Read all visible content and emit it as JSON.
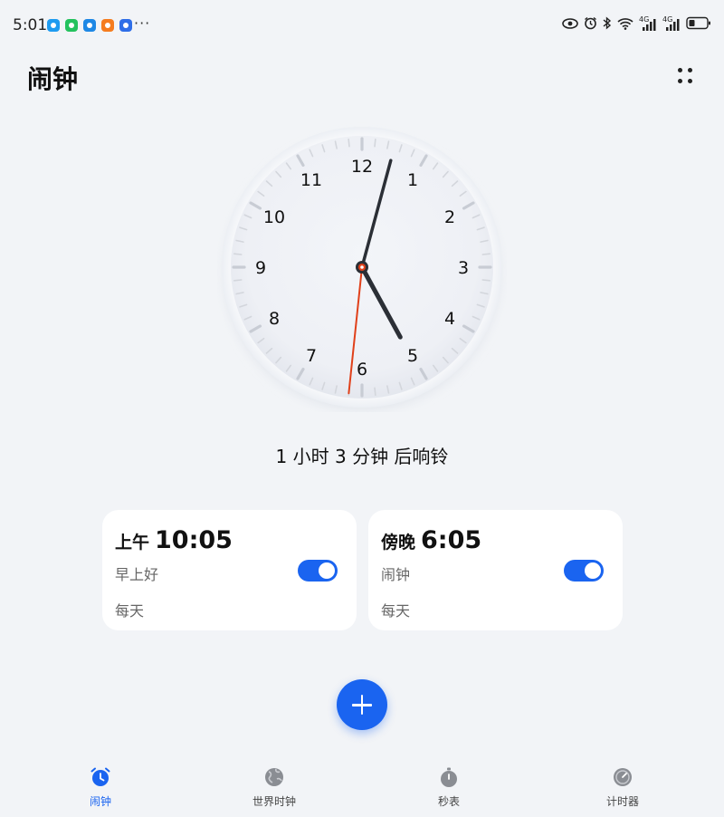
{
  "status_bar": {
    "time": "5:01",
    "more": "···",
    "signal_label_1": "4G",
    "signal_label_2": "4G",
    "app_colors": [
      "#1e9bf0",
      "#24c25e",
      "#1e88e5",
      "#f57c1f",
      "#2f6ee8"
    ]
  },
  "header": {
    "title": "闹钟",
    "menu_icon": "more-grid-icon"
  },
  "clock": {
    "numerals": [
      "12",
      "1",
      "2",
      "3",
      "4",
      "5",
      "6",
      "7",
      "8",
      "9",
      "10",
      "11"
    ],
    "time_shown": {
      "hour": 5,
      "minute": 2,
      "second": 31
    },
    "hand_color": "#2b2f36",
    "second_hand_color": "#e0401a"
  },
  "countdown_text": "1 小时 3 分钟 后响铃",
  "alarms": [
    {
      "period": "上午",
      "time": "10:05",
      "label": "早上好",
      "repeat": "每天",
      "enabled": true
    },
    {
      "period": "傍晚",
      "time": "6:05",
      "label": "闹钟",
      "repeat": "每天",
      "enabled": true
    }
  ],
  "fab": {
    "icon": "plus-icon",
    "color": "#1a64f0"
  },
  "nav": {
    "items": [
      {
        "label": "闹钟",
        "icon": "alarm-clock-icon",
        "active": true
      },
      {
        "label": "世界时钟",
        "icon": "globe-icon",
        "active": false
      },
      {
        "label": "秒表",
        "icon": "stopwatch-icon",
        "active": false
      },
      {
        "label": "计时器",
        "icon": "timer-icon",
        "active": false
      }
    ],
    "active_color": "#1a64f0",
    "inactive_color": "#8a8d93"
  }
}
